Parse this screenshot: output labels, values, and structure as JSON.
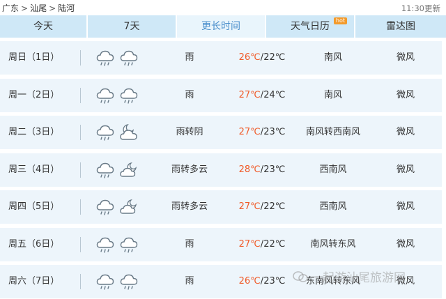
{
  "breadcrumb": [
    "广东",
    "汕尾",
    "陆河"
  ],
  "update_time": "11:30更新",
  "tabs": [
    {
      "label": "今天",
      "active": false
    },
    {
      "label": "7天",
      "active": false
    },
    {
      "label": "更长时间",
      "active": true
    },
    {
      "label": "天气日历",
      "badge": "hot",
      "active": false
    },
    {
      "label": "雷达图",
      "active": false
    }
  ],
  "forecast": [
    {
      "day": "周日（1日）",
      "icons": [
        "rain-cloud-icon",
        "rain-cloud-icon"
      ],
      "weather": "雨",
      "high": "26℃",
      "low": "22℃",
      "wind": "南风",
      "level": "微风"
    },
    {
      "day": "周一（2日）",
      "icons": [
        "rain-cloud-icon",
        "rain-cloud-icon"
      ],
      "weather": "雨",
      "high": "27℃",
      "low": "24℃",
      "wind": "南风",
      "level": "微风"
    },
    {
      "day": "周二（3日）",
      "icons": [
        "rain-cloud-icon",
        "overcast-night-icon"
      ],
      "weather": "雨转阴",
      "high": "27℃",
      "low": "23℃",
      "wind": "南风转西南风",
      "level": "微风"
    },
    {
      "day": "周三（4日）",
      "icons": [
        "rain-cloud-icon",
        "partly-cloudy-night-icon"
      ],
      "weather": "雨转多云",
      "high": "28℃",
      "low": "23℃",
      "wind": "西南风",
      "level": "微风"
    },
    {
      "day": "周四（5日）",
      "icons": [
        "rain-cloud-icon",
        "partly-cloudy-night-icon"
      ],
      "weather": "雨转多云",
      "high": "27℃",
      "low": "22℃",
      "wind": "西南风",
      "level": "微风"
    },
    {
      "day": "周五（6日）",
      "icons": [
        "rain-cloud-icon",
        "rain-cloud-icon"
      ],
      "weather": "雨",
      "high": "27℃",
      "low": "22℃",
      "wind": "南风转东风",
      "level": "微风"
    },
    {
      "day": "周六（7日）",
      "icons": [
        "rain-cloud-icon",
        "rain-cloud-icon"
      ],
      "weather": "雨",
      "high": "26℃",
      "low": "23℃",
      "wind": "东南风转东风",
      "level": "微风"
    }
  ],
  "watermark": "一起游汕尾旅游网",
  "colors": {
    "tab_bg": "#cfe8f7",
    "tab_active_bg": "#e9f5fc",
    "tab_active_text": "#4a8fcc",
    "row_bg": "#edf5fb",
    "high_temp": "#f05a28",
    "hot_badge": "#f39a2b"
  }
}
